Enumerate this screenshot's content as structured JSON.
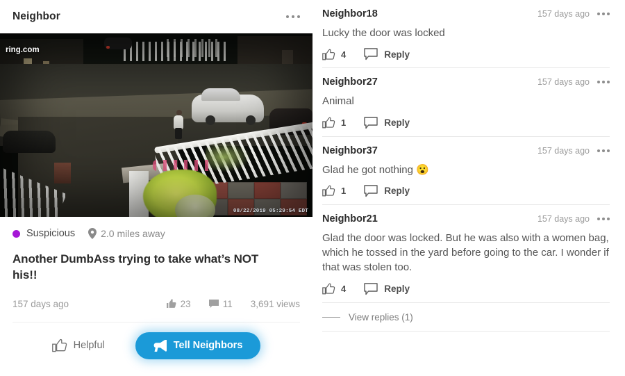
{
  "post": {
    "header_title": "Neighbor",
    "menu_icon": "kebab-menu-icon",
    "video": {
      "watermark_brand": "ring",
      "watermark_suffix": ".com",
      "timestamp_overlay": "08/22/2019 05:29:54 EDT"
    },
    "category": "Suspicious",
    "category_color": "#a517d6",
    "distance": "2.0 miles away",
    "title": "Another DumbAss trying to take what’s NOT his!!",
    "time_ago": "157 days ago",
    "likes": "23",
    "comments": "11",
    "views": "3,691 views",
    "helpful_label": "Helpful",
    "tell_neighbors_label": "Tell Neighbors",
    "tell_neighbors_color": "#1b9ad8"
  },
  "comments": [
    {
      "user": "Neighbor18",
      "time": "157 days ago",
      "text": "Lucky the door was locked",
      "likes": "4",
      "reply_label": "Reply"
    },
    {
      "user": "Neighbor27",
      "time": "157 days ago",
      "text": "Animal",
      "likes": "1",
      "reply_label": "Reply"
    },
    {
      "user": "Neighbor37",
      "time": "157 days ago",
      "text": "Glad he got nothing 😮",
      "likes": "1",
      "reply_label": "Reply"
    },
    {
      "user": "Neighbor21",
      "time": "157 days ago",
      "text": "Glad the door was locked. But he was also with a women bag, which he tossed in the yard before going to the car. I wonder if that was stolen too.",
      "likes": "4",
      "reply_label": "Reply"
    }
  ],
  "view_replies_label": "View replies (1)"
}
